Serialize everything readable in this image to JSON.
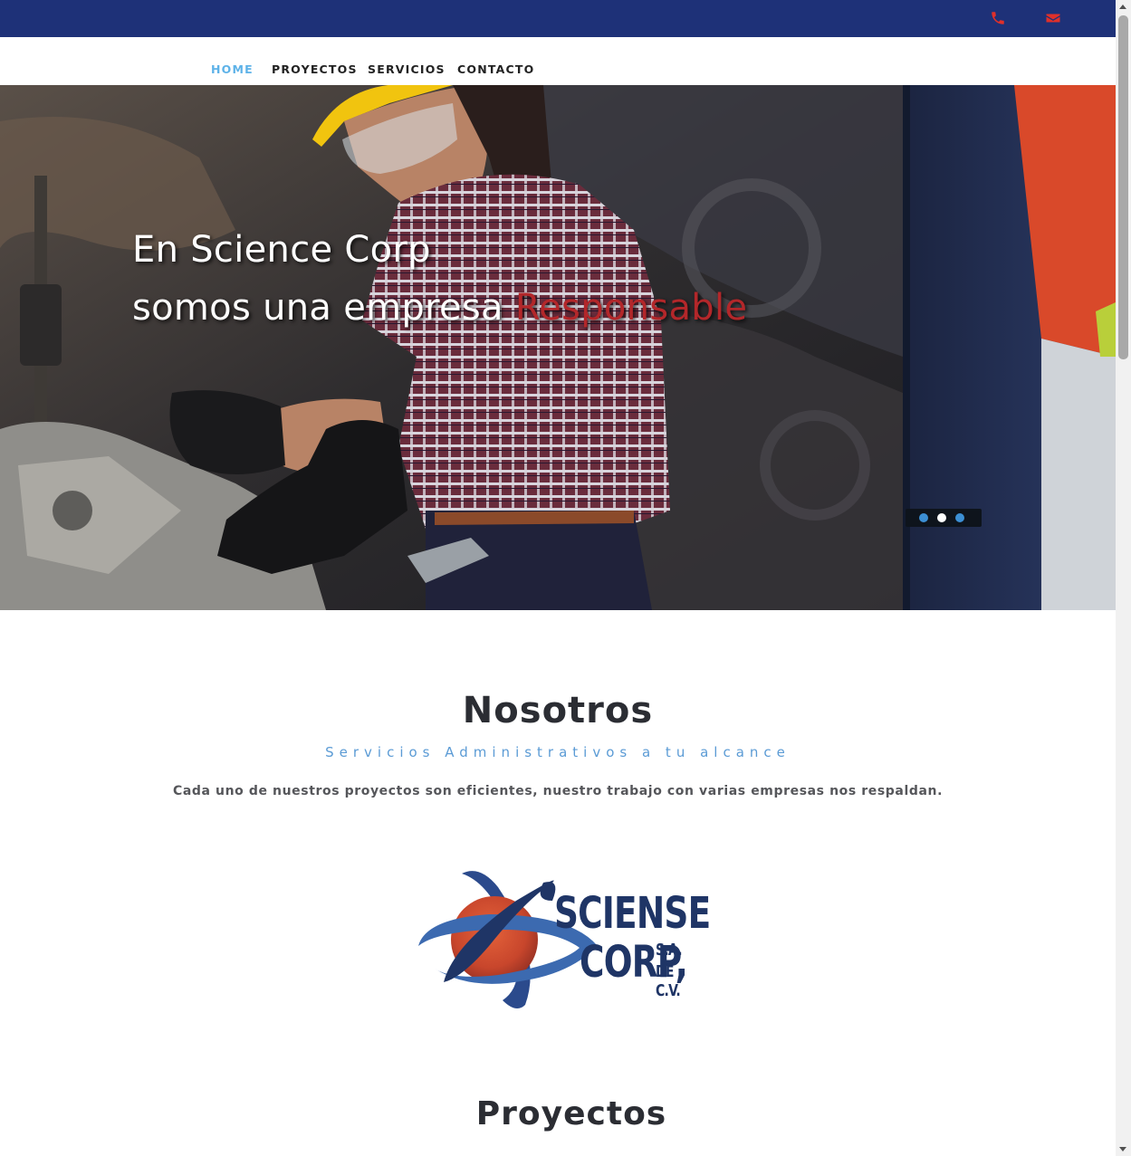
{
  "topbar": {
    "background": "#1e3178",
    "icon_color": "#e0302a",
    "phone_icon": "phone-icon",
    "mail_icon": "envelope-icon"
  },
  "nav": {
    "items": [
      "HOME",
      "PROYECTOS",
      "SERVICIOS",
      "CONTACTO"
    ],
    "active_color": "#5db2e8"
  },
  "hero": {
    "line1": "En Science Corp",
    "line2": "somos una empresa",
    "accent": "Responsable",
    "accent_color": "#b3272a",
    "slides": 3,
    "active_slide": 2
  },
  "about": {
    "title": "Nosotros",
    "subtitle": "Servicios Administrativos a tu alcance",
    "description": "Cada uno de nuestros proyectos son eficientes, nuestro trabajo con varias empresas nos respaldan."
  },
  "logo": {
    "line1": "SCIENSE",
    "line2": "CORP,",
    "suffix1": "S.A.",
    "suffix2": "DE C.V."
  },
  "projects": {
    "title": "Proyectos"
  }
}
